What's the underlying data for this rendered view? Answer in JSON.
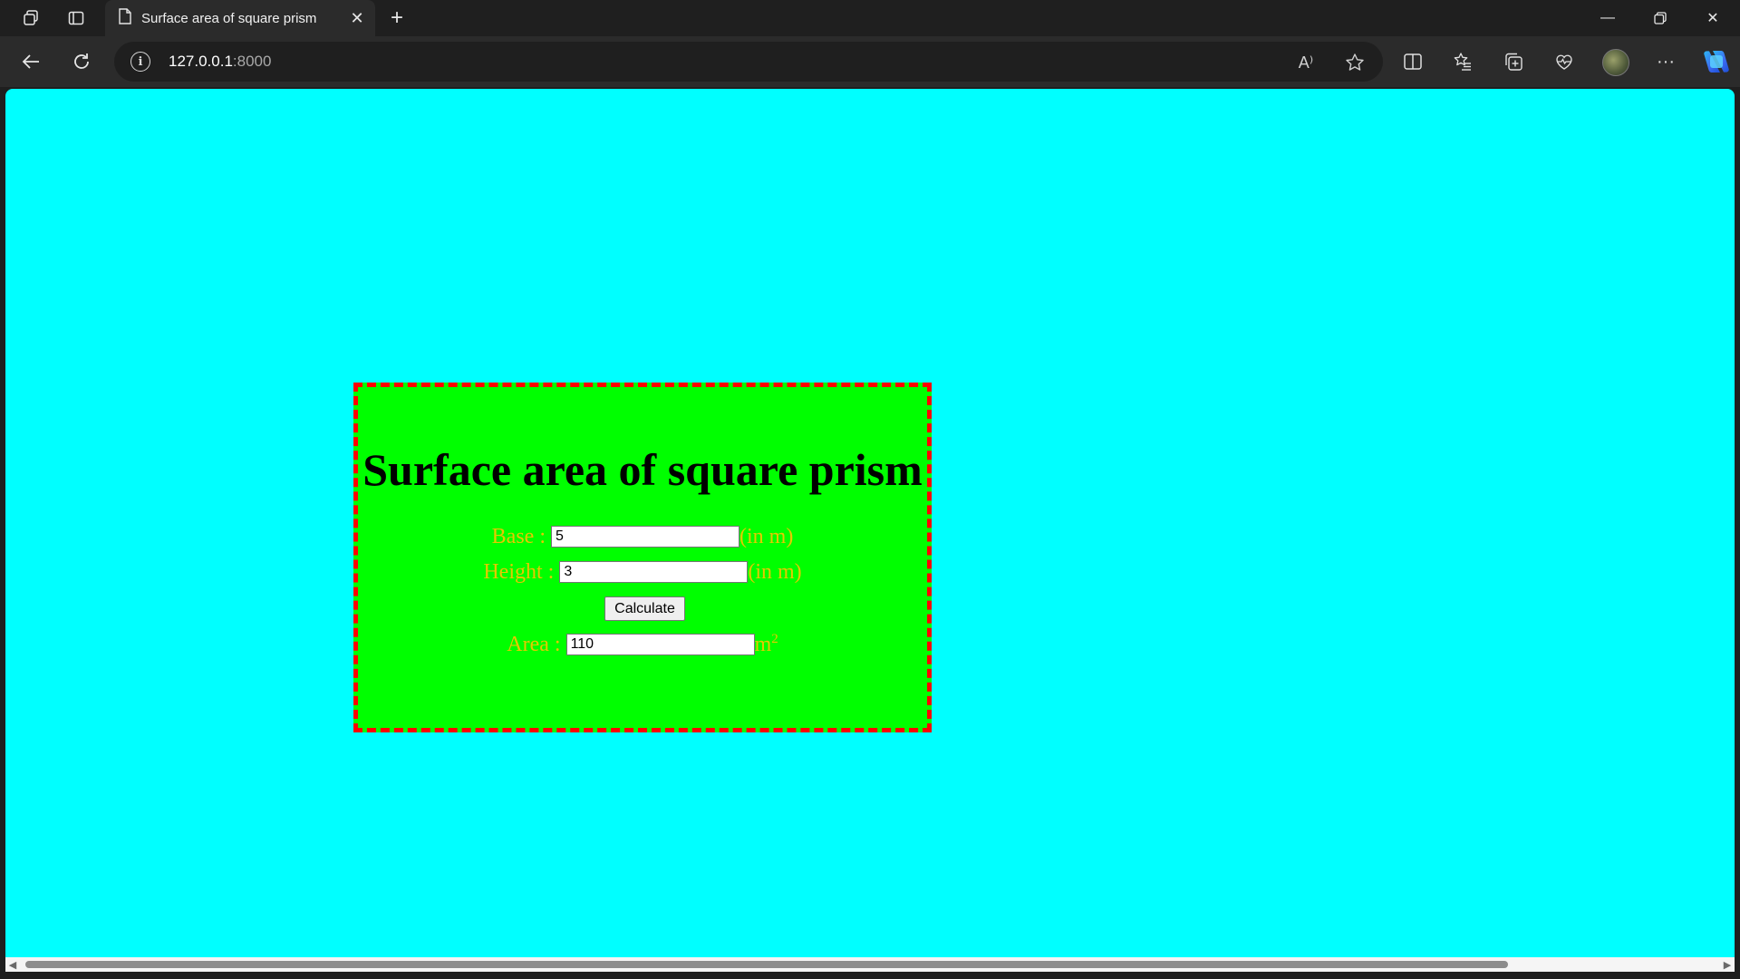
{
  "browser": {
    "tab_title": "Surface area of square prism",
    "url_host": "127.0.0.1",
    "url_port": ":8000",
    "read_aloud_glyph": "A⁾"
  },
  "icons": {
    "workspaces": "workspaces-icon",
    "tab_actions": "tab-actions-icon",
    "page": "page-icon",
    "close": "close-icon",
    "new_tab": "plus-icon",
    "minimize": "minimize-icon",
    "restore": "restore-icon",
    "window_close": "close-icon",
    "back": "back-arrow-icon",
    "refresh": "refresh-icon",
    "info": "info-icon",
    "read_aloud": "read-aloud-icon",
    "favorite": "star-icon",
    "split": "split-screen-icon",
    "favorites": "favorites-icon",
    "collections": "collections-icon",
    "health": "browser-essentials-icon",
    "more": "more-icon",
    "copilot": "copilot-icon"
  },
  "page": {
    "background": "#00ffff",
    "box_background": "#00ff00",
    "box_border": "#ff0000",
    "label_color": "#e6c800",
    "title": "Surface area of square prism",
    "base_label": "Base :",
    "base_value": "5",
    "base_unit": "(in m)",
    "height_label": "Height :",
    "height_value": "3",
    "height_unit": "(in m)",
    "calculate_label": "Calculate",
    "area_label": "Area :",
    "area_value": "110",
    "area_unit": "m",
    "area_unit_exp": "2"
  }
}
